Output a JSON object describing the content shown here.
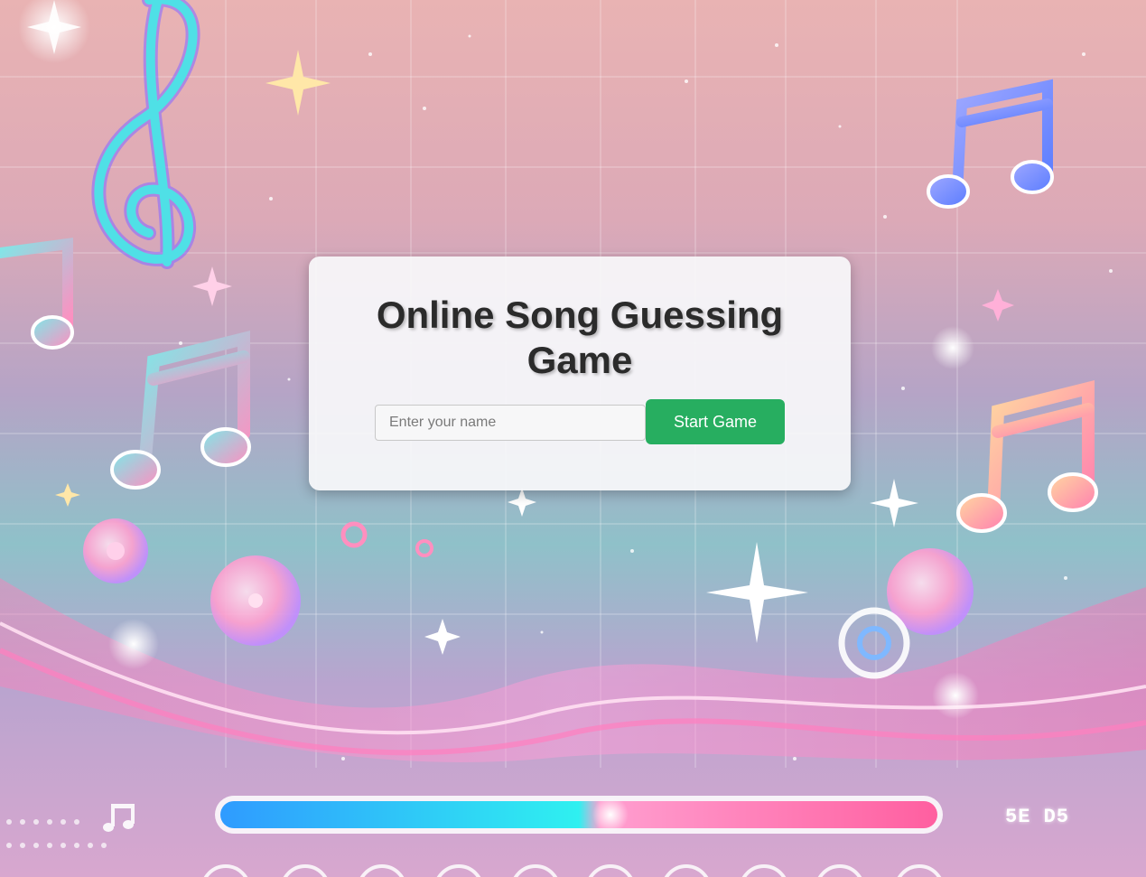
{
  "game": {
    "title": "Online Song Guessing Game",
    "name_placeholder": "Enter your name",
    "name_value": "",
    "start_label": "Start Game"
  },
  "background": {
    "player_time_label": "5E D5",
    "colors": {
      "card_bg": "#f8f8fa",
      "start_button": "#27ae60",
      "title_text": "#2b2b2b",
      "progress_left": "#22ccf0",
      "progress_right": "#ff6aa8"
    },
    "icons": [
      "treble-clef-icon",
      "music-note-icon",
      "sparkle-icon",
      "disc-icon"
    ]
  }
}
